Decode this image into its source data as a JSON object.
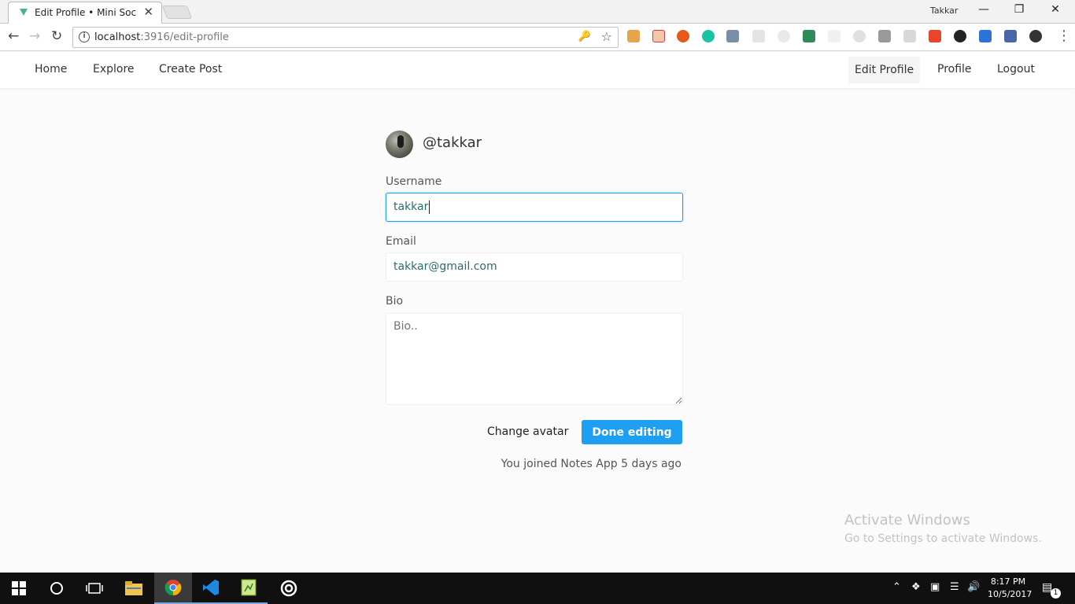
{
  "browser": {
    "tab_title": "Edit Profile • Mini Social",
    "tab_close": "✕",
    "profile_name": "Takkar",
    "url_host": "localhost",
    "url_path": ":3916/edit-profile",
    "win_minimize": "—",
    "win_restore": "❐",
    "win_close": "✕"
  },
  "nav": {
    "home": "Home",
    "explore": "Explore",
    "create_post": "Create Post",
    "edit_profile": "Edit Profile",
    "profile": "Profile",
    "logout": "Logout"
  },
  "profile": {
    "handle": "@takkar"
  },
  "form": {
    "username_label": "Username",
    "username_value": "takkar",
    "email_label": "Email",
    "email_value": "takkar@gmail.com",
    "bio_label": "Bio",
    "bio_placeholder": "Bio..",
    "change_avatar": "Change avatar",
    "done_button": "Done editing",
    "joined_text": "You joined Notes App 5 days ago"
  },
  "watermark": {
    "title": "Activate Windows",
    "subtitle": "Go to Settings to activate Windows."
  },
  "taskbar": {
    "time": "8:17 PM",
    "date": "10/5/2017",
    "notification_count": "1"
  },
  "colors": {
    "accent": "#1e9ff2",
    "taskbar": "#101010"
  }
}
